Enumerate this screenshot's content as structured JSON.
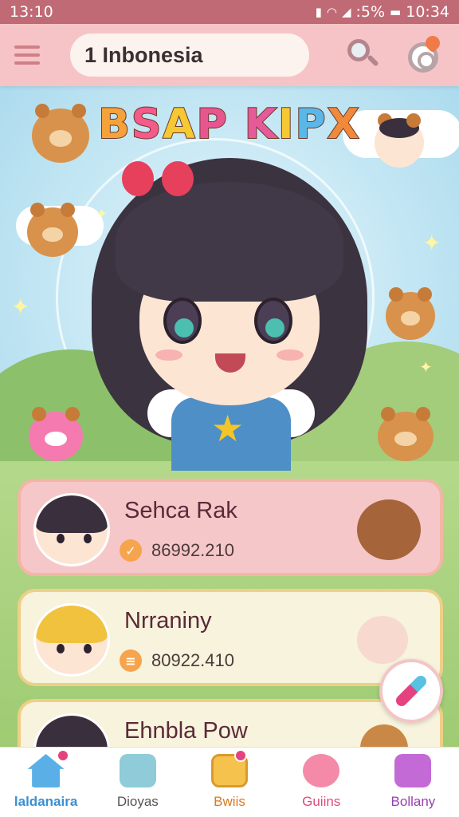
{
  "status_bar": {
    "time_left": "13:10",
    "battery": ":5%",
    "time_right": "10:34"
  },
  "header": {
    "search_text": "1 Inbonesia",
    "menu_icon": "hamburger-icon",
    "search_icon": "magnifier-icon",
    "target_icon": "target-heart-icon"
  },
  "hero": {
    "title_letters": [
      "B",
      "S",
      "A",
      "P",
      " ",
      "K",
      "I",
      "P",
      "X"
    ],
    "title_colors": [
      "#f6a23b",
      "#f45a8a",
      "#f6c833",
      "#e8568f",
      "#ffffff",
      "#e65a9a",
      "#f6c833",
      "#5ab7e8",
      "#f08a3a"
    ]
  },
  "cards": [
    {
      "name": "Sehca Rak",
      "value": "86992.210",
      "coin": "✓",
      "hair": "#3a2f3d",
      "accent": "#f3c52f"
    },
    {
      "name": "Nrraniny",
      "value": "80922.410",
      "coin": "≡",
      "hair": "#f1c23d",
      "accent": "#f1c23d"
    },
    {
      "name": "Ehnbla Pow",
      "value": "",
      "coin": "",
      "hair": "#3a2f3d",
      "accent": "#e6405c"
    }
  ],
  "fab_icon": "pen-icon",
  "nav": [
    {
      "label": "laldanaira",
      "color": "#3e8fd0",
      "icon_color": "#5ab0e6",
      "icon": "home-icon",
      "active": true
    },
    {
      "label": "Dioyas",
      "color": "#555555",
      "icon_color": "#8fcbd8",
      "icon": "mail-icon",
      "active": false
    },
    {
      "label": "Bwiis",
      "color": "#d97a1f",
      "icon_color": "#f6c24e",
      "icon": "note-icon",
      "active": false
    },
    {
      "label": "Guiins",
      "color": "#e14b7a",
      "icon_color": "#f48aa8",
      "icon": "pet-icon",
      "active": false
    },
    {
      "label": "Bollany",
      "color": "#9b3fb0",
      "icon_color": "#c46ad6",
      "icon": "camera-icon",
      "active": false
    }
  ]
}
